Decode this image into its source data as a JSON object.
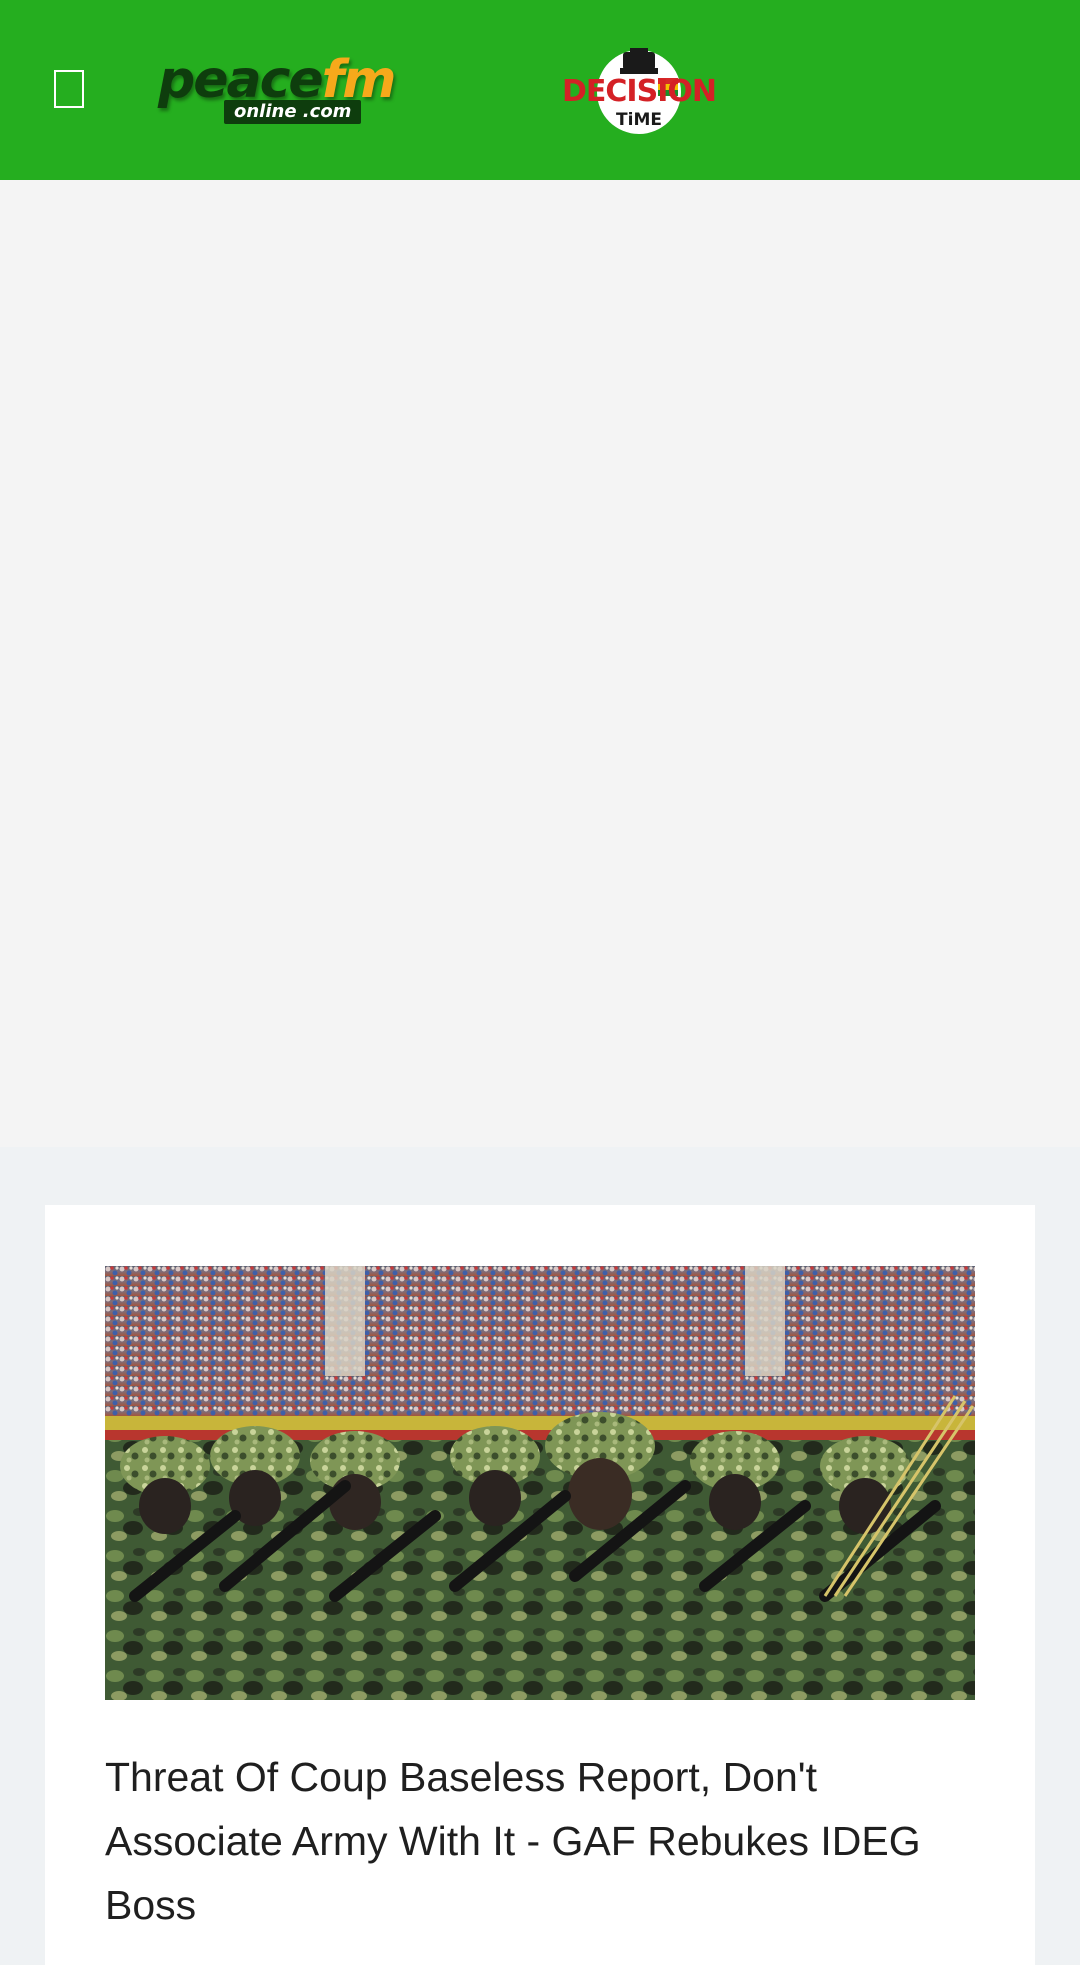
{
  "header": {
    "background": "#25ae1f",
    "menu_icon": "menu-toggle-icon",
    "logo": {
      "main_part1": "peace",
      "main_part2": "fm",
      "sub": "online .com"
    },
    "secondary_logo": {
      "word1": "DECISION",
      "word2": "TiME"
    }
  },
  "ad_area": {
    "background": "#f4f4f4"
  },
  "article": {
    "image_alt": "Soldiers in camouflage uniforms and helmets marching with rifles in front of a stadium crowd",
    "title": "Threat Of Coup Baseless Report, Don't Associate Army With It - GAF Rebukes IDEG Boss"
  }
}
